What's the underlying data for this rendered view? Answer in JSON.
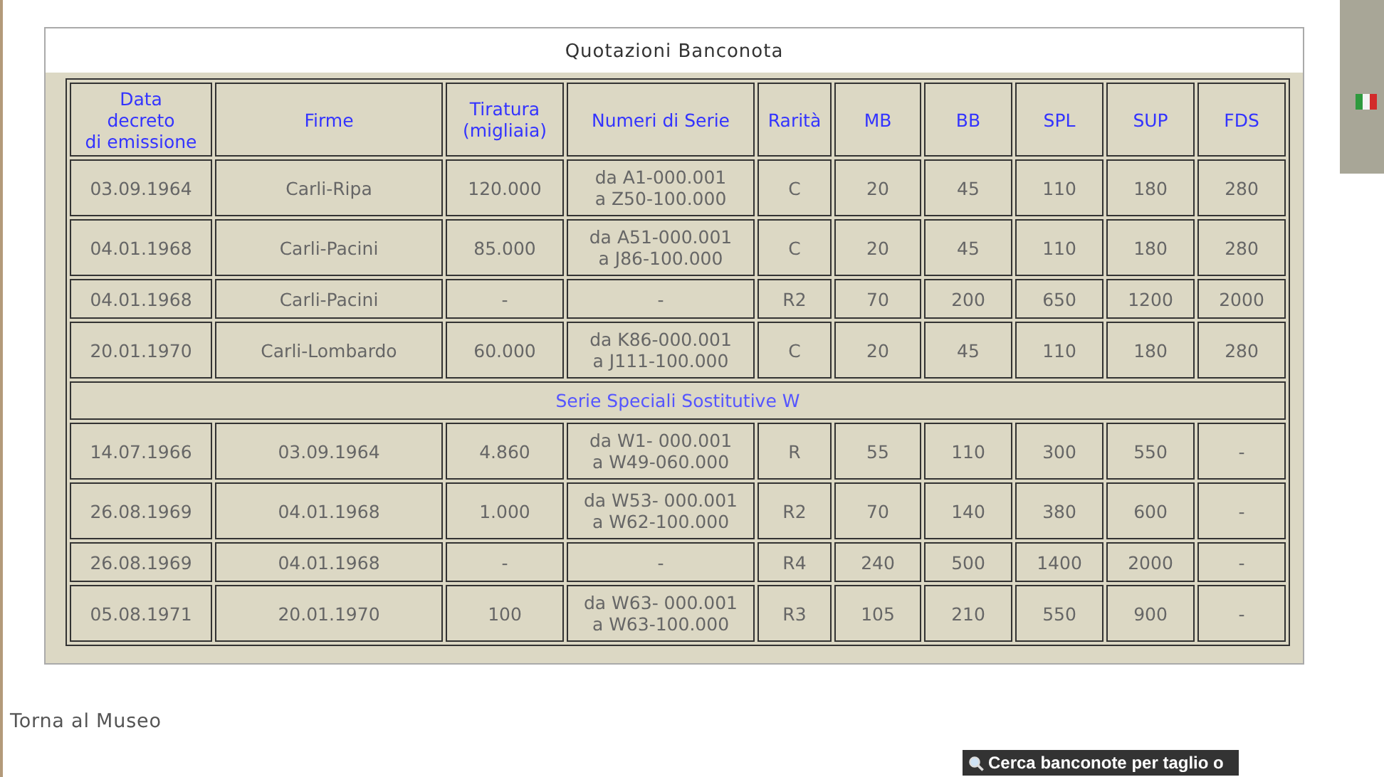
{
  "panel": {
    "title": "Quotazioni Banconota"
  },
  "table": {
    "columns": [
      "Data\ndecreto\ndi emissione",
      "Firme",
      "Tiratura\n(migliaia)",
      "Numeri di Serie",
      "Rarità",
      "MB",
      "BB",
      "SPL",
      "SUP",
      "FDS"
    ],
    "rows": [
      {
        "kind": "row",
        "cells": [
          "03.09.1964",
          "Carli-Ripa",
          "120.000",
          "da A1-000.001\na Z50-100.000",
          "C",
          "20",
          "45",
          "110",
          "180",
          "280"
        ]
      },
      {
        "kind": "row",
        "cells": [
          "04.01.1968",
          "Carli-Pacini",
          "85.000",
          "da A51-000.001\na J86-100.000",
          "C",
          "20",
          "45",
          "110",
          "180",
          "280"
        ]
      },
      {
        "kind": "row",
        "cells": [
          "04.01.1968",
          "Carli-Pacini",
          "-",
          "-",
          "R2",
          "70",
          "200",
          "650",
          "1200",
          "2000"
        ]
      },
      {
        "kind": "row",
        "cells": [
          "20.01.1970",
          "Carli-Lombardo",
          "60.000",
          "da K86-000.001\na J111-100.000",
          "C",
          "20",
          "45",
          "110",
          "180",
          "280"
        ]
      },
      {
        "kind": "section",
        "label": "Serie Speciali Sostitutive W"
      },
      {
        "kind": "row",
        "cells": [
          "14.07.1966",
          "03.09.1964",
          "4.860",
          "da W1- 000.001\na W49-060.000",
          "R",
          "55",
          "110",
          "300",
          "550",
          "-"
        ]
      },
      {
        "kind": "row",
        "cells": [
          "26.08.1969",
          "04.01.1968",
          "1.000",
          "da W53- 000.001\na W62-100.000",
          "R2",
          "70",
          "140",
          "380",
          "600",
          "-"
        ]
      },
      {
        "kind": "row",
        "cells": [
          "26.08.1969",
          "04.01.1968",
          "-",
          "-",
          "R4",
          "240",
          "500",
          "1400",
          "2000",
          "-"
        ]
      },
      {
        "kind": "row",
        "cells": [
          "05.08.1971",
          "20.01.1970",
          "100",
          "da W63- 000.001\na W63-100.000",
          "R3",
          "105",
          "210",
          "550",
          "900",
          "-"
        ]
      }
    ]
  },
  "back_link": "Torna al Museo",
  "search_button": "Cerca banconote per taglio o"
}
